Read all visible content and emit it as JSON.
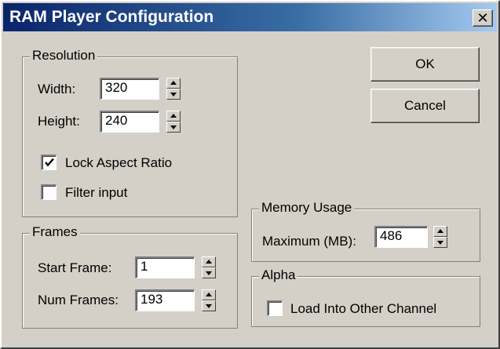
{
  "window": {
    "title": "RAM Player Configuration",
    "close_glyph": "✕"
  },
  "resolution": {
    "label": "Resolution",
    "width_label": "Width:",
    "width_value": "320",
    "height_label": "Height:",
    "height_value": "240",
    "lock_aspect_label": "Lock Aspect Ratio",
    "lock_aspect_checked": true,
    "filter_label": "Filter input",
    "filter_checked": false
  },
  "frames": {
    "label": "Frames",
    "start_label": "Start Frame:",
    "start_value": "1",
    "num_label": "Num Frames:",
    "num_value": "193"
  },
  "memory": {
    "label": "Memory Usage",
    "max_label": "Maximum (MB):",
    "max_value": "486"
  },
  "alpha": {
    "label": "Alpha",
    "load_label": "Load Into Other Channel",
    "load_checked": false
  },
  "buttons": {
    "ok": "OK",
    "cancel": "Cancel"
  }
}
